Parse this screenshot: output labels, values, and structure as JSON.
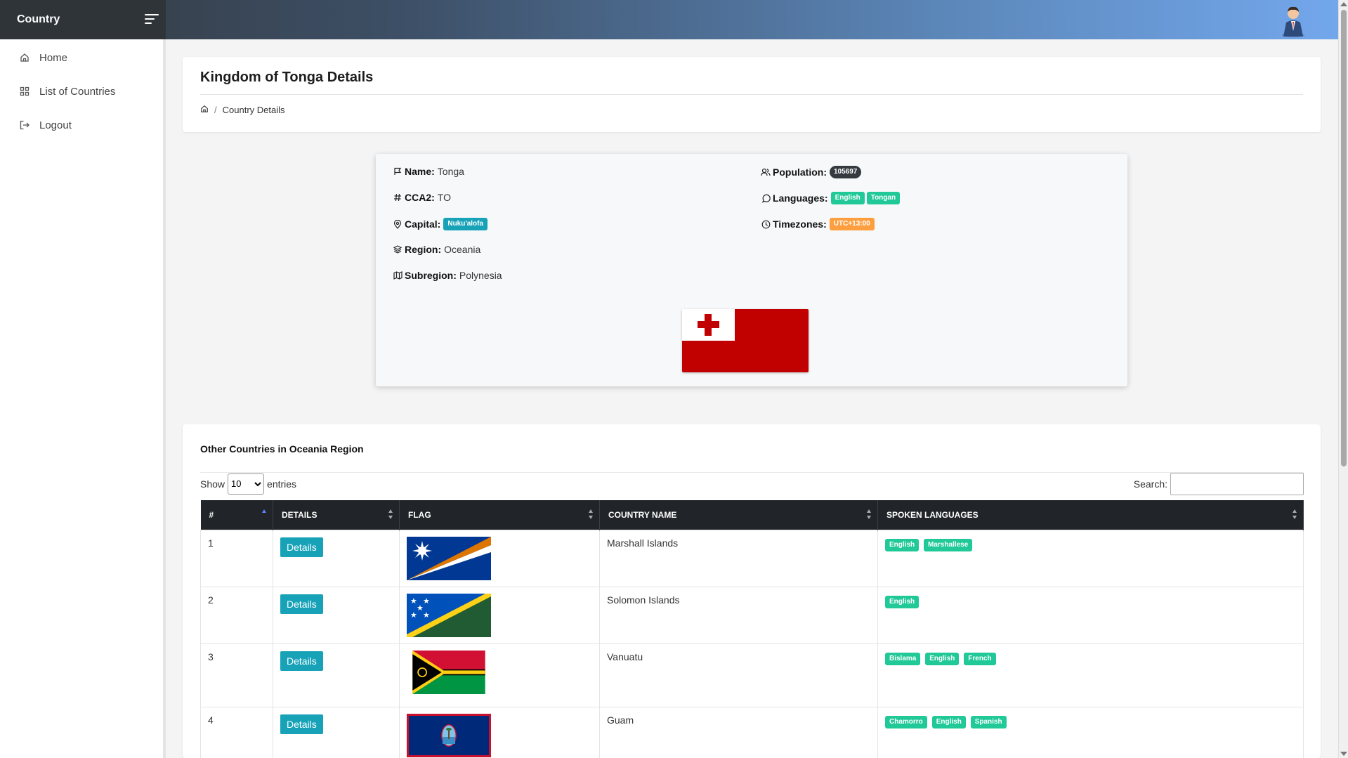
{
  "brand": "Country",
  "sidebar": {
    "items": [
      {
        "label": "Home",
        "icon": "home-icon"
      },
      {
        "label": "List of Countries",
        "icon": "grid-icon"
      },
      {
        "label": "Logout",
        "icon": "logout-icon"
      }
    ]
  },
  "header": {
    "title": "Kingdom of Tonga Details",
    "breadcrumb": {
      "current": "Country Details"
    }
  },
  "details": {
    "name_label": "Name:",
    "name": "Tonga",
    "cca2_label": "CCA2:",
    "cca2": "TO",
    "capital_label": "Capital:",
    "capital": "Nuku'alofa",
    "region_label": "Region:",
    "region": "Oceania",
    "subregion_label": "Subregion:",
    "subregion": "Polynesia",
    "population_label": "Population:",
    "population": "105697",
    "languages_label": "Languages:",
    "languages": [
      "English",
      "Tongan"
    ],
    "timezones_label": "Timezones:",
    "timezone": "UTC+13:00"
  },
  "table_section": {
    "title": "Other Countries in Oceania Region",
    "show_label": "Show",
    "entries_label": "entries",
    "page_size": "10",
    "search_label": "Search:",
    "search_value": "",
    "columns": [
      "#",
      "DETAILS",
      "FLAG",
      "COUNTRY NAME",
      "SPOKEN LANGUAGES"
    ],
    "details_button": "Details",
    "rows": [
      {
        "num": "1",
        "name": "Marshall Islands",
        "flag": "marshall-islands-flag",
        "languages": [
          "English",
          "Marshallese"
        ]
      },
      {
        "num": "2",
        "name": "Solomon Islands",
        "flag": "solomon-islands-flag",
        "languages": [
          "English"
        ]
      },
      {
        "num": "3",
        "name": "Vanuatu",
        "flag": "vanuatu-flag",
        "languages": [
          "Bislama",
          "English",
          "French"
        ]
      },
      {
        "num": "4",
        "name": "Guam",
        "flag": "guam-flag",
        "languages": [
          "Chamorro",
          "English",
          "Spanish"
        ]
      }
    ]
  },
  "colors": {
    "badge_teal": "#20c997",
    "badge_cyan": "#17a2b8",
    "badge_orange": "#fd9e3f",
    "badge_dark": "#343a40",
    "table_header": "#212529",
    "button": "#17a2b8"
  }
}
